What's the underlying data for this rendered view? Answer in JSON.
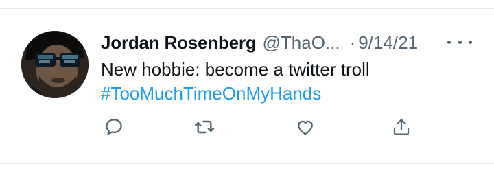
{
  "tweet": {
    "author_name": "Jordan Rosenberg",
    "handle": "@ThaO...",
    "separator": "·",
    "date": "9/14/21",
    "text": "New hobbie: become a twitter troll",
    "hashtag": "#TooMuchTimeOnMyHands"
  },
  "icons": {
    "avatar": "avatar-photo",
    "more": "more-options-icon",
    "reply": "reply-icon",
    "retweet": "retweet-icon",
    "like": "heart-icon",
    "share": "share-icon"
  },
  "colors": {
    "text": "#0f1419",
    "secondary": "#536471",
    "link": "#1d9bf0",
    "divider": "#e6e8ea"
  }
}
